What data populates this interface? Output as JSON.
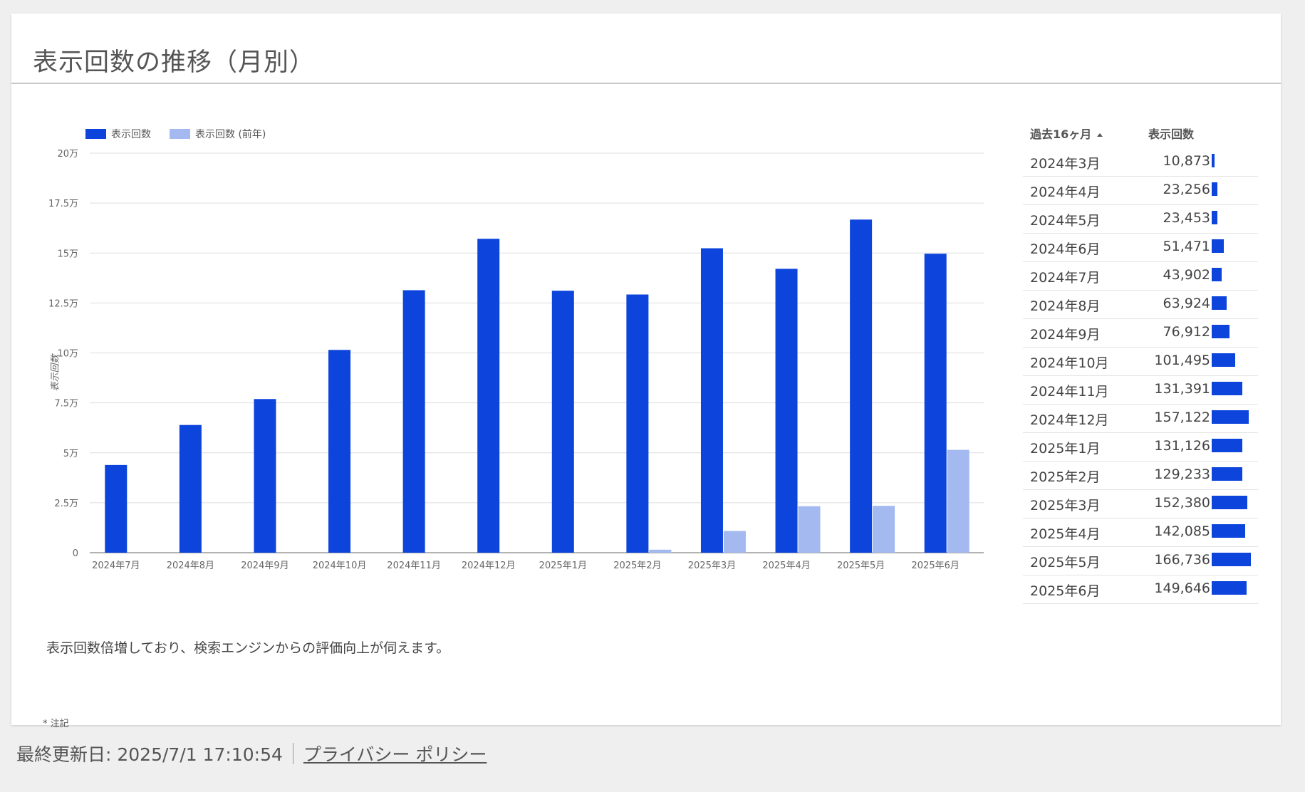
{
  "card": {
    "title": "表示回数の推移（月別）",
    "note": "表示回数倍増しており、検索エンジンからの評価向上が伺えます。",
    "footnote": "* 注記"
  },
  "footer": {
    "updated": "最終更新日: 2025/7/1 17:10:54",
    "privacy": "プライバシー ポリシー"
  },
  "colors": {
    "current": "#0c44dc",
    "previous": "#a4b9f0"
  },
  "chart_data": {
    "type": "bar",
    "categories": [
      "2024年7月",
      "2024年8月",
      "2024年9月",
      "2024年10月",
      "2024年11月",
      "2024年12月",
      "2025年1月",
      "2025年2月",
      "2025年3月",
      "2025年4月",
      "2025年5月",
      "2025年6月"
    ],
    "series": [
      {
        "name": "表示回数",
        "values": [
          43902,
          63924,
          76912,
          101495,
          131391,
          157122,
          131126,
          129233,
          152380,
          142085,
          166736,
          149646
        ]
      },
      {
        "name": "表示回数 (前年)",
        "values": [
          0,
          0,
          0,
          0,
          0,
          0,
          0,
          1500,
          10873,
          23256,
          23453,
          51471
        ]
      }
    ],
    "ylabel": "表示回数",
    "ylim": [
      0,
      200000
    ],
    "yticks": [
      "0",
      "2.5万",
      "5万",
      "7.5万",
      "10万",
      "12.5万",
      "15万",
      "17.5万",
      "20万"
    ],
    "legend_position": "top-left",
    "grid": true
  },
  "table": {
    "headers": {
      "month": "過去16ヶ月",
      "value": "表示回数"
    },
    "rows": [
      {
        "month": "2024年3月",
        "value": "10,873",
        "num": 10873
      },
      {
        "month": "2024年4月",
        "value": "23,256",
        "num": 23256
      },
      {
        "month": "2024年5月",
        "value": "23,453",
        "num": 23453
      },
      {
        "month": "2024年6月",
        "value": "51,471",
        "num": 51471
      },
      {
        "month": "2024年7月",
        "value": "43,902",
        "num": 43902
      },
      {
        "month": "2024年8月",
        "value": "63,924",
        "num": 63924
      },
      {
        "month": "2024年9月",
        "value": "76,912",
        "num": 76912
      },
      {
        "month": "2024年10月",
        "value": "101,495",
        "num": 101495
      },
      {
        "month": "2024年11月",
        "value": "131,391",
        "num": 131391
      },
      {
        "month": "2024年12月",
        "value": "157,122",
        "num": 157122
      },
      {
        "month": "2025年1月",
        "value": "131,126",
        "num": 131126
      },
      {
        "month": "2025年2月",
        "value": "129,233",
        "num": 129233
      },
      {
        "month": "2025年3月",
        "value": "152,380",
        "num": 152380
      },
      {
        "month": "2025年4月",
        "value": "142,085",
        "num": 142085
      },
      {
        "month": "2025年5月",
        "value": "166,736",
        "num": 166736
      },
      {
        "month": "2025年6月",
        "value": "149,646",
        "num": 149646
      }
    ]
  }
}
